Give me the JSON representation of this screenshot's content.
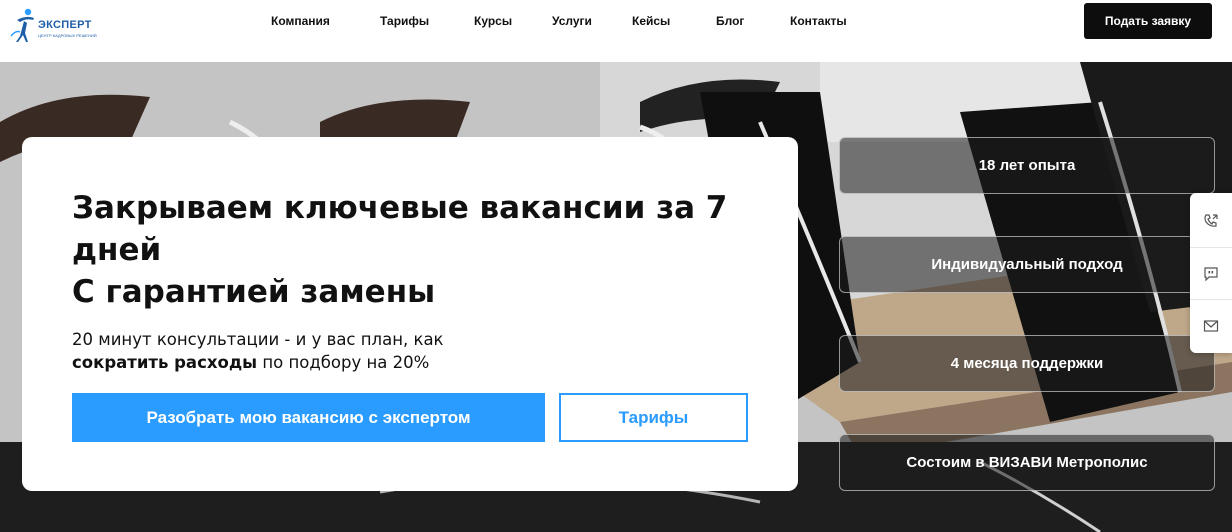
{
  "header": {
    "logo": {
      "name": "ЭКСПЕРТ",
      "tagline": "ЦЕНТР КАДРОВЫХ РЕШЕНИЙ"
    },
    "nav": [
      "Компания",
      "Тарифы",
      "Курсы",
      "Услуги",
      "Кейсы",
      "Блог",
      "Контакты"
    ],
    "cta_label": "Подать заявку"
  },
  "hero": {
    "title_line1": "Закрываем ключевые вакансии за 7 дней",
    "title_line2": "С гарантией замены",
    "subtitle_part1": "20 минут консультации - и у вас план, как",
    "subtitle_bold": "сократить расходы",
    "subtitle_part2": "по подбору на 20%",
    "primary_button": "Разобрать мою вакансию с экспертом",
    "secondary_button": "Тарифы"
  },
  "features": [
    "18 лет опыта",
    "Индивидуальный подход",
    "4 месяца поддержки",
    "Состоим в ВИЗАВИ Метрополис"
  ],
  "side_widget": {
    "items": [
      {
        "icon": "phone-callback-icon"
      },
      {
        "icon": "chat-quote-icon"
      },
      {
        "icon": "mail-icon"
      }
    ]
  },
  "colors": {
    "accent": "#2a9bff",
    "dark_button": "#0d0d0d",
    "logo_blue": "#1f5fa8"
  }
}
